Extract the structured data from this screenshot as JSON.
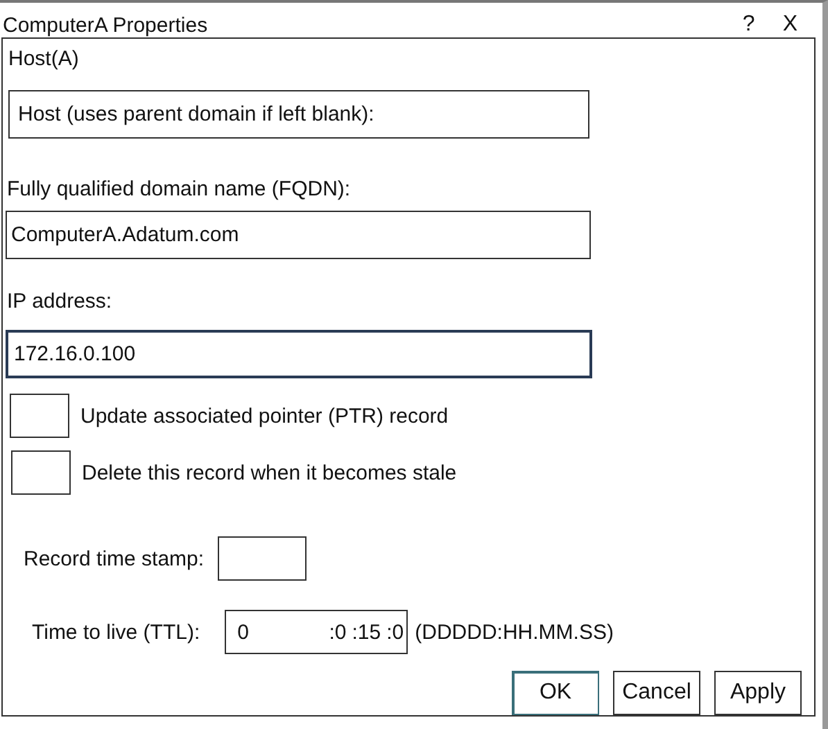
{
  "window": {
    "title": "ComputerA Properties",
    "help": "?",
    "close": "X"
  },
  "tab": {
    "label": "Host(A)"
  },
  "host": {
    "placeholder": "Host (uses parent domain if left blank):"
  },
  "fqdn": {
    "label": "Fully qualified domain name (FQDN):",
    "value": "ComputerA.Adatum.com"
  },
  "ip": {
    "label": "IP address:",
    "value": "172.16.0.100",
    "focused": true
  },
  "checkboxes": [
    {
      "label": "Update associated pointer (PTR) record",
      "checked": false
    },
    {
      "label": "Delete this record when it becomes stale",
      "checked": false
    }
  ],
  "timestamp": {
    "label": "Record time stamp:"
  },
  "ttl": {
    "label": "Time to live (TTL):",
    "parts": [
      "0",
      ":0",
      ":15",
      ":0"
    ],
    "format": "(DDDDD:HH.MM.SS)"
  },
  "buttons": [
    {
      "label": "OK",
      "default": true
    },
    {
      "label": "Cancel",
      "default": false
    },
    {
      "label": "Apply",
      "default": false
    }
  ]
}
